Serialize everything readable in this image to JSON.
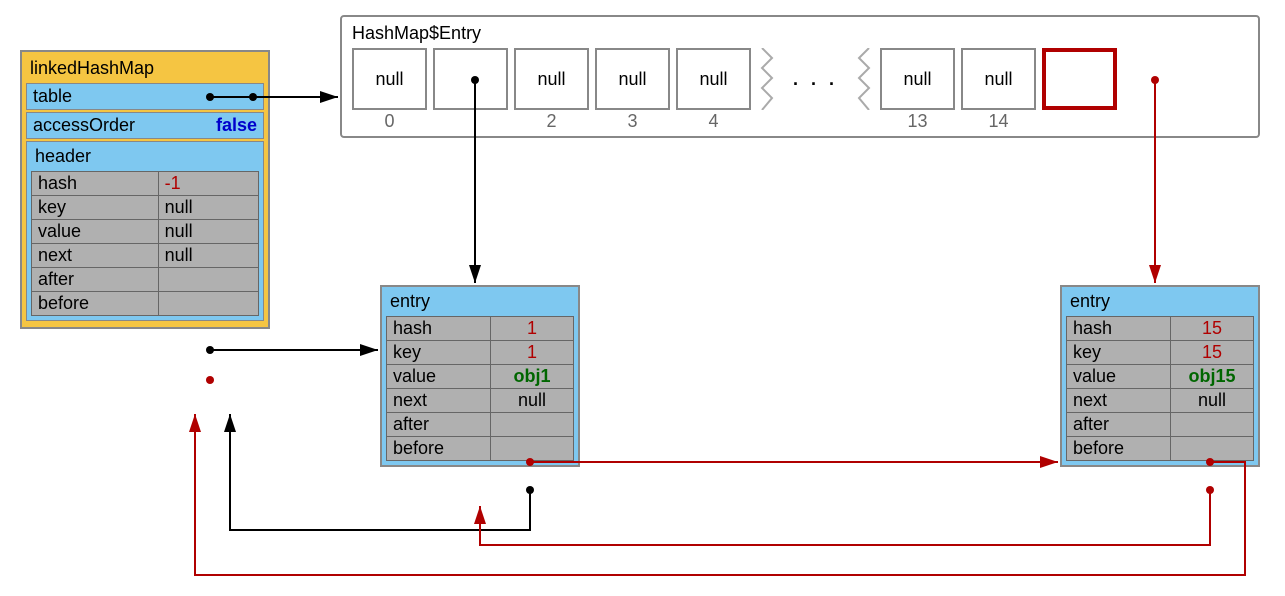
{
  "linkedHashMap": {
    "title": "linkedHashMap",
    "table_label": "table",
    "accessOrder_label": "accessOrder",
    "accessOrder_value": "false",
    "header_label": "header",
    "header": {
      "hash_label": "hash",
      "hash": "-1",
      "key_label": "key",
      "key": "null",
      "value_label": "value",
      "value": "null",
      "next_label": "next",
      "next": "null",
      "after_label": "after",
      "before_label": "before"
    }
  },
  "array": {
    "title": "HashMap$Entry",
    "slots": [
      {
        "text": "null",
        "idx": "0"
      },
      {
        "text": "",
        "idx": ""
      },
      {
        "text": "null",
        "idx": "2"
      },
      {
        "text": "null",
        "idx": "3"
      },
      {
        "text": "null",
        "idx": "4"
      },
      {
        "text": "null",
        "idx": "13"
      },
      {
        "text": "null",
        "idx": "14"
      },
      {
        "text": "",
        "idx": ""
      }
    ],
    "ellipsis": ". . ."
  },
  "entry1": {
    "title": "entry",
    "hash_label": "hash",
    "hash": "1",
    "key_label": "key",
    "key": "1",
    "value_label": "value",
    "value": "obj1",
    "next_label": "next",
    "next": "null",
    "after_label": "after",
    "before_label": "before"
  },
  "entry15": {
    "title": "entry",
    "hash_label": "hash",
    "hash": "15",
    "key_label": "key",
    "key": "15",
    "value_label": "value",
    "value": "obj15",
    "next_label": "next",
    "next": "null",
    "after_label": "after",
    "before_label": "before"
  }
}
